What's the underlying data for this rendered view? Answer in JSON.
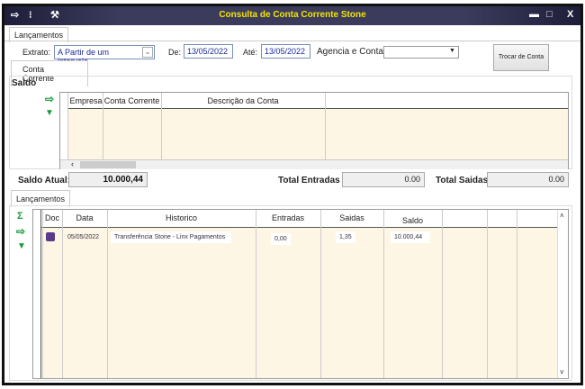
{
  "window": {
    "title": "Consulta de Conta Corrente Stone",
    "minimize": "▬",
    "maximize": "□",
    "close": "X"
  },
  "tabs": {
    "main": "Lançamentos",
    "sub": "Conta Corrente",
    "lower": "Lançamentos"
  },
  "filters": {
    "extrato_label": "Extrato:",
    "extrato_value": "A Partir de um intervalo",
    "de_label": "De:",
    "de_value": "13/05/2022",
    "ate_label": "Até:",
    "ate_value": "13/05/2022",
    "agencia_label": "Agencia e Conta",
    "agencia_value": "",
    "trocar_button": "Trocar de Conta"
  },
  "saldo": {
    "group_label": "Saldo",
    "columns": [
      "Empresa",
      "Conta Corrente",
      "Descrição da Conta"
    ],
    "saldo_atual_label": "Saldo Atual:",
    "saldo_atual_value": "10.000,44",
    "total_entradas_label": "Total Entradas",
    "total_entradas_value": "0.00",
    "total_saidas_label": "Total Saidas",
    "total_saidas_value": "0.00"
  },
  "lancamentos": {
    "columns": [
      "Doc",
      "Data",
      "Historico",
      "Entradas",
      "Saidas",
      "Saldo",
      "",
      "",
      ""
    ],
    "rows": [
      {
        "data": "05/05/2022",
        "historico": "Transferência Stone - Linx Pagamentos",
        "entradas": "0,00",
        "saidas": "1,35",
        "saldo": "10.000,44"
      }
    ]
  }
}
